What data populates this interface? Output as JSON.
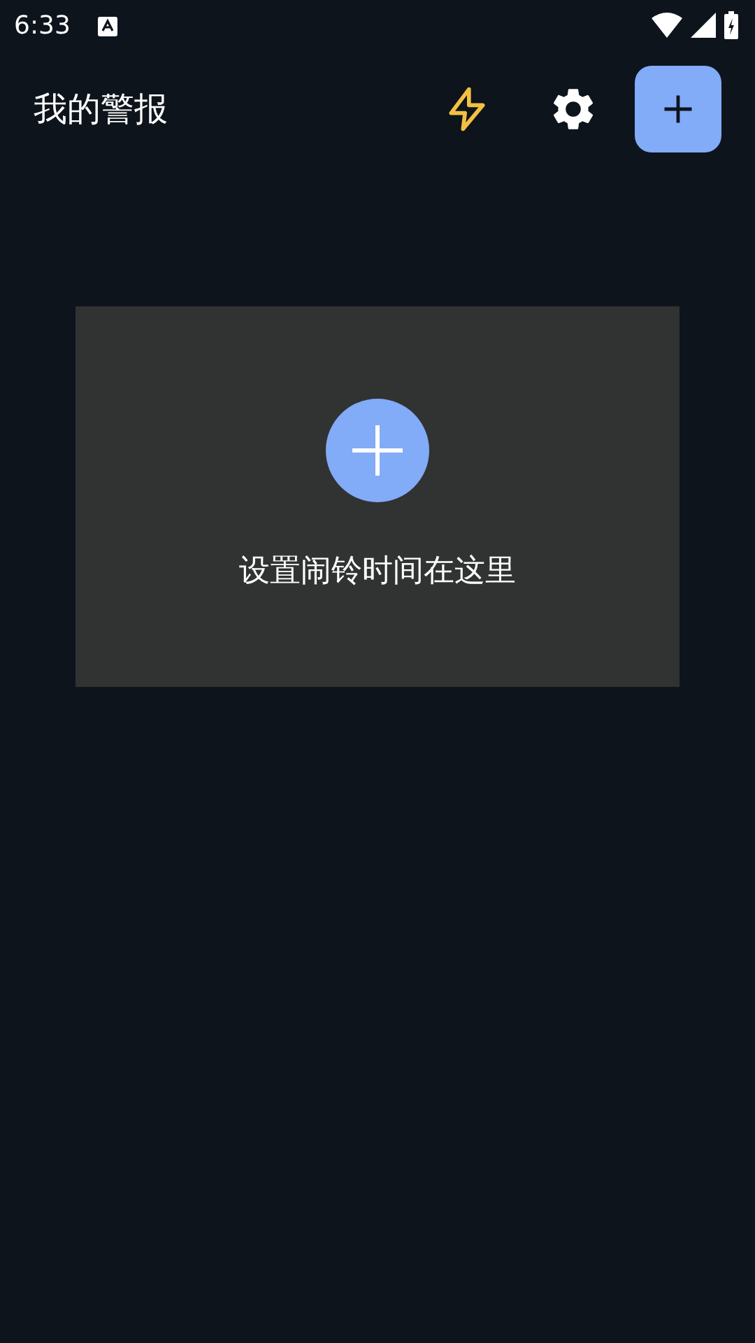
{
  "status_bar": {
    "time": "6:33"
  },
  "app_bar": {
    "title": "我的警报"
  },
  "empty_card": {
    "message": "设置闹铃时间在这里"
  }
}
